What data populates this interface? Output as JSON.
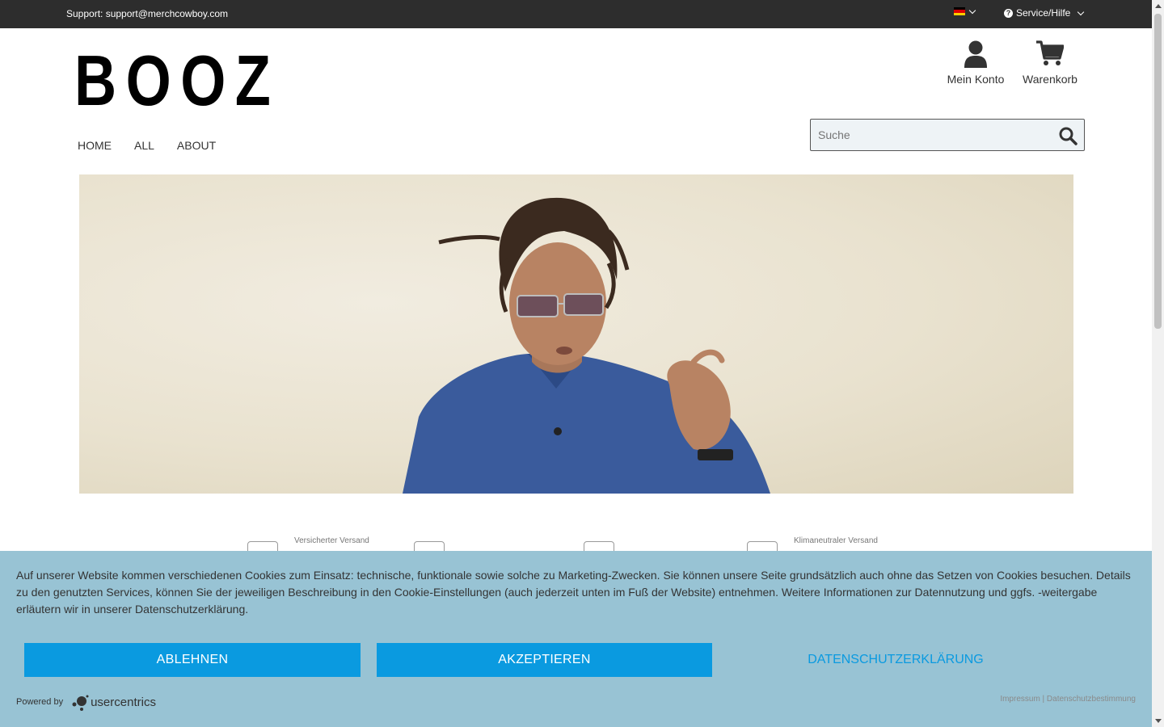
{
  "topbar": {
    "support": "Support: support@merchcowboy.com",
    "service_label": "Service/Hilfe",
    "flag_colors": [
      "#000000",
      "#dd0000",
      "#ffce00"
    ]
  },
  "header": {
    "logo": "BOOZ",
    "account_label": "Mein Konto",
    "cart_label": "Warenkorb"
  },
  "nav": {
    "items": [
      "HOME",
      "ALL",
      "ABOUT"
    ]
  },
  "search": {
    "placeholder": "Suche"
  },
  "features": [
    {
      "label": "Versicherter Versand",
      "icon": "truck-icon"
    },
    {
      "label": "",
      "icon": "return-icon"
    },
    {
      "label": "",
      "icon": "leaf-icon"
    },
    {
      "label": "Klimaneutraler Versand",
      "icon": "cart-leaf-icon"
    }
  ],
  "cookie": {
    "text": "Auf unserer Website kommen verschiedenen Cookies zum Einsatz: technische, funktionale sowie solche zu Marketing-Zwecken. Sie können unsere Seite grundsätzlich auch ohne das Setzen von Cookies besuchen. Details zu den genutzten Services, können Sie der jeweiligen Beschreibung in den Cookie-Einstellungen (auch jederzeit unten im Fuß der Website) entnehmen. Weitere Informationen zur Datennutzung und ggfs. -weitergabe erläutern wir in unserer Datenschutzerklärung.",
    "decline_label": "ABLEHNEN",
    "accept_label": "AKZEPTIEREN",
    "privacy_label": "DATENSCHUTZERKLÄRUNG",
    "powered_by": "Powered by",
    "brand": "usercentrics",
    "footer_links": "Impressum | Datenschutzbestimmung"
  },
  "colors": {
    "topbar_bg": "#2d2d2d",
    "banner_bg": "#98c3d4",
    "button_blue": "#0a9ae0"
  }
}
